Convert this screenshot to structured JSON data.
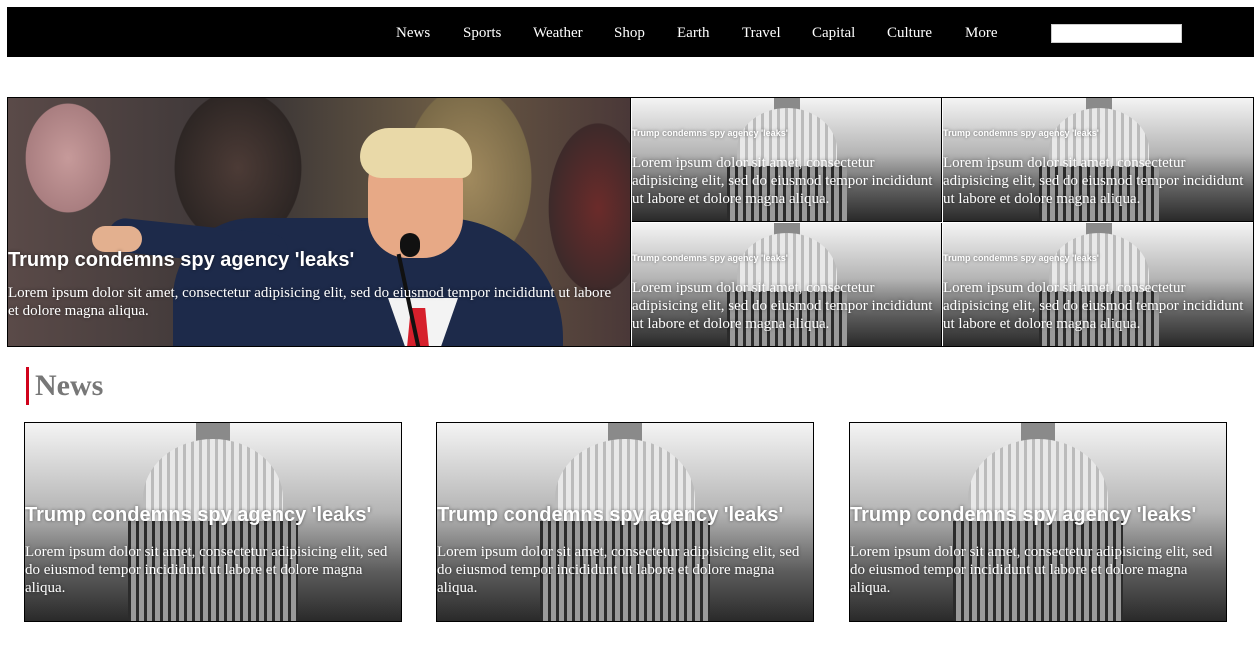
{
  "nav": {
    "items": [
      "News",
      "Sports",
      "Weather",
      "Shop",
      "Earth",
      "Travel",
      "Capital",
      "Culture",
      "More"
    ],
    "search": {
      "value": "",
      "placeholder": ""
    }
  },
  "hero": {
    "main": {
      "title": "Trump condemns spy agency 'leaks'",
      "text": "Lorem ipsum dolor sit amet, consectetur adipisicing elit, sed do eiusmod tempor incididunt ut labore et dolore magna aliqua."
    },
    "small": [
      {
        "title": "Trump condemns spy agency 'leaks'",
        "text": "Lorem ipsum dolor sit amet, consectetur adipisicing elit, sed do eiusmod tempor incididunt ut labore et dolore magna aliqua."
      },
      {
        "title": "Trump condemns spy agency 'leaks'",
        "text": "Lorem ipsum dolor sit amet, consectetur adipisicing elit, sed do eiusmod tempor incididunt ut labore et dolore magna aliqua."
      },
      {
        "title": "Trump condemns spy agency 'leaks'",
        "text": "Lorem ipsum dolor sit amet, consectetur adipisicing elit, sed do eiusmod tempor incididunt ut labore et dolore magna aliqua."
      },
      {
        "title": "Trump condemns spy agency 'leaks'",
        "text": "Lorem ipsum dolor sit amet, consectetur adipisicing elit, sed do eiusmod tempor incididunt ut labore et dolore magna aliqua."
      }
    ]
  },
  "news": {
    "heading": "News",
    "cards": [
      {
        "title": "Trump condemns spy agency 'leaks'",
        "text": "Lorem ipsum dolor sit amet, consectetur adipisicing elit, sed do eiusmod tempor incididunt ut labore et dolore magna aliqua."
      },
      {
        "title": "Trump condemns spy agency 'leaks'",
        "text": "Lorem ipsum dolor sit amet, consectetur adipisicing elit, sed do eiusmod tempor incididunt ut labore et dolore magna aliqua."
      },
      {
        "title": "Trump condemns spy agency 'leaks'",
        "text": "Lorem ipsum dolor sit amet, consectetur adipisicing elit, sed do eiusmod tempor incididunt ut labore et dolore magna aliqua."
      }
    ]
  },
  "colors": {
    "nav_bg": "#000000",
    "accent": "#d0021b",
    "heading": "#777777"
  }
}
